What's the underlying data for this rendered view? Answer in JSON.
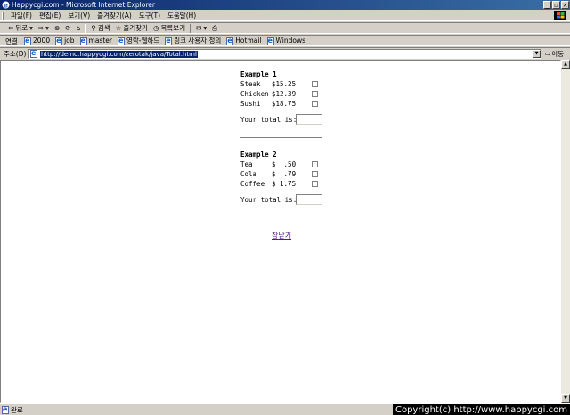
{
  "window": {
    "title": "Happycgi.com - Microsoft Internet Explorer",
    "buttons": [
      "_",
      "▫",
      "×"
    ]
  },
  "menubar": {
    "items": [
      "파일(F)",
      "편집(E)",
      "보기(V)",
      "즐겨찾기(A)",
      "도구(T)",
      "도움말(H)"
    ]
  },
  "toolbar": {
    "back": "뒤로",
    "search": "검색",
    "favorites": "즐겨찾기",
    "history": "목록보기"
  },
  "links": {
    "label": "연결",
    "items": [
      "2000",
      "job",
      "master",
      "영락-웹하드",
      "링크 사용자 정의",
      "Hotmail",
      "Windows"
    ]
  },
  "address": {
    "label": "주소(D)",
    "url": "http://demo.happycgi.com/zerotak/java/Total.html",
    "go": "이동"
  },
  "page": {
    "example1": {
      "title": "Example 1",
      "items": [
        {
          "name": "Steak",
          "price": "$15.25"
        },
        {
          "name": "Chicken",
          "price": "$12.39"
        },
        {
          "name": "Sushi",
          "price": "$18.75"
        }
      ],
      "total_label": "Your total is:",
      "total_value": ""
    },
    "example2": {
      "title": "Example 2",
      "items": [
        {
          "name": "Tea",
          "price": "$  .50"
        },
        {
          "name": "Cola",
          "price": "$  .79"
        },
        {
          "name": "Coffee",
          "price": "$ 1.75"
        }
      ],
      "total_label": "Your total is:",
      "total_value": ""
    },
    "close_link": "창닫기"
  },
  "status": {
    "text": "완료",
    "copyright": "Copyright(c) http://www.happycgi.com"
  }
}
